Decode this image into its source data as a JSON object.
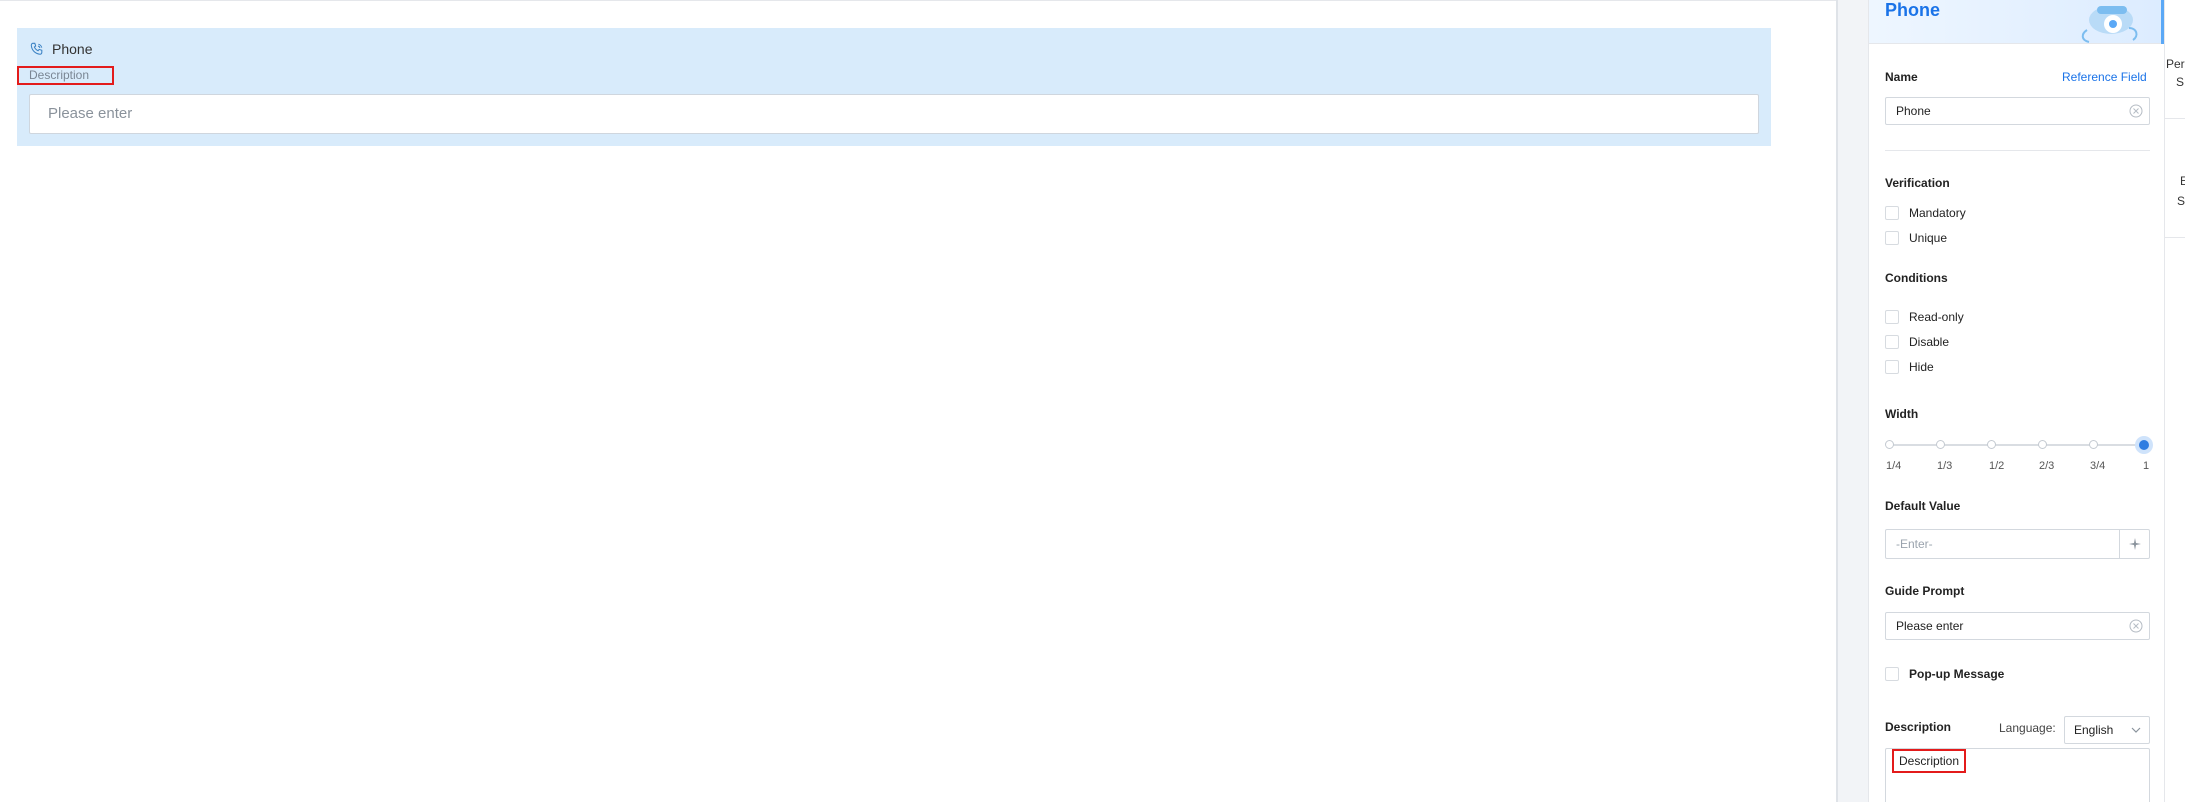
{
  "canvas": {
    "field": {
      "title": "Phone",
      "icon": "phone-icon",
      "description": "Description",
      "placeholder": "Please enter"
    }
  },
  "panel": {
    "title": "Phone",
    "name_label": "Name",
    "reference_field_link": "Reference Field",
    "name_value": "Phone",
    "verification_label": "Verification",
    "verification_options": [
      "Mandatory",
      "Unique"
    ],
    "conditions_label": "Conditions",
    "conditions_options": [
      "Read-only",
      "Disable",
      "Hide"
    ],
    "width_label": "Width",
    "width_ticks": [
      "1/4",
      "1/3",
      "1/2",
      "2/3",
      "3/4",
      "1"
    ],
    "width_selected": "1",
    "default_value_label": "Default Value",
    "default_value_placeholder": "-Enter-",
    "guide_prompt_label": "Guide Prompt",
    "guide_prompt_value": "Please enter",
    "popup_label": "Pop-up Message",
    "description_label": "Description",
    "language_label": "Language:",
    "language_value": "English",
    "description_value": "Description"
  },
  "far_right": {
    "items": [
      "Per",
      "S",
      "E",
      "S"
    ]
  },
  "colors": {
    "accent": "#1a73e8",
    "field_bg": "#d8ebfb",
    "highlight": "#e31b1b"
  }
}
